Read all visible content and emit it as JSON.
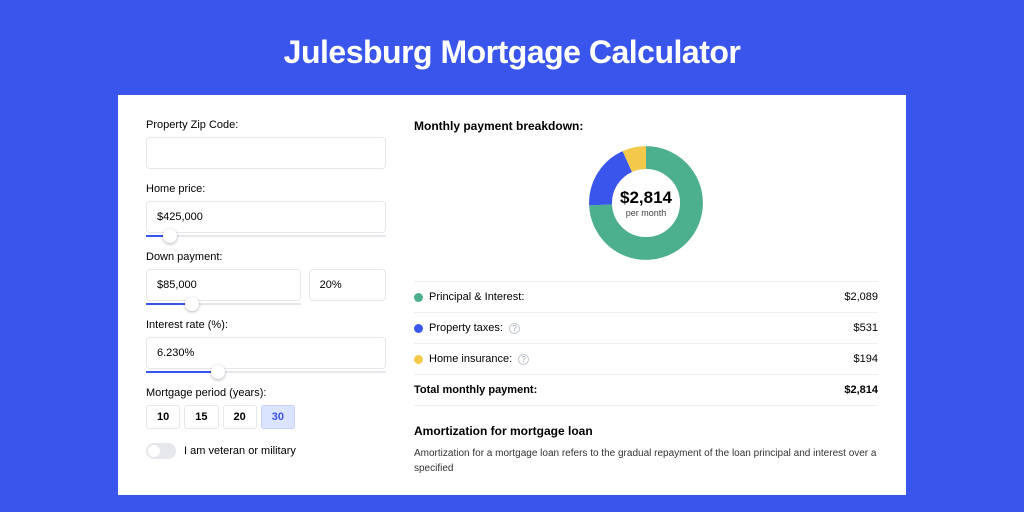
{
  "title": "Julesburg Mortgage Calculator",
  "form": {
    "zip_label": "Property Zip Code:",
    "zip_value": "",
    "price_label": "Home price:",
    "price_value": "$425,000",
    "price_slider_percent": 10,
    "down_label": "Down payment:",
    "down_value": "$85,000",
    "down_percent_value": "20%",
    "down_slider_percent": 20,
    "rate_label": "Interest rate (%):",
    "rate_value": "6.230%",
    "rate_slider_percent": 30,
    "period_label": "Mortgage period (years):",
    "periods": [
      "10",
      "15",
      "20",
      "30"
    ],
    "period_active_index": 3,
    "toggle_label": "I am veteran or military"
  },
  "breakdown": {
    "title": "Monthly payment breakdown:",
    "donut_value": "$2,814",
    "donut_sub": "per month",
    "rows": [
      {
        "label": "Principal & Interest:",
        "value": "$2,089",
        "color": "g",
        "info": false
      },
      {
        "label": "Property taxes:",
        "value": "$531",
        "color": "b",
        "info": true
      },
      {
        "label": "Home insurance:",
        "value": "$194",
        "color": "y",
        "info": true
      }
    ],
    "total_label": "Total monthly payment:",
    "total_value": "$2,814"
  },
  "amort": {
    "title": "Amortization for mortgage loan",
    "body": "Amortization for a mortgage loan refers to the gradual repayment of the loan principal and interest over a specified"
  },
  "chart_data": {
    "type": "pie",
    "title": "Monthly payment breakdown",
    "series": [
      {
        "name": "Principal & Interest",
        "value": 2089,
        "color": "#4caf8e"
      },
      {
        "name": "Property taxes",
        "value": 531,
        "color": "#3a55ec"
      },
      {
        "name": "Home insurance",
        "value": 194,
        "color": "#f3c94b"
      }
    ],
    "total": 2814
  }
}
